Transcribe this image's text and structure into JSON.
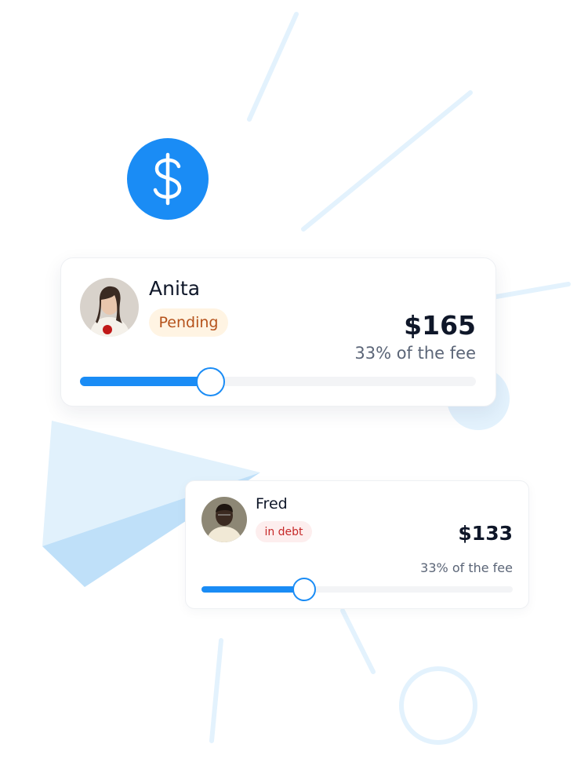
{
  "accent_color": "#1a8cf5",
  "header": {
    "icon": "dollar-icon"
  },
  "cards": [
    {
      "name": "Anita",
      "status": "Pending",
      "status_color": "#b5521b",
      "status_bg": "#fff4e3",
      "amount": "$165",
      "share_text": "33% of the fee",
      "slider_fraction": 0.33,
      "avatar_icon": "avatar-anita"
    },
    {
      "name": "Fred",
      "status": "in debt",
      "status_color": "#c62828",
      "status_bg": "#fdeeee",
      "amount": "$133",
      "share_text": "33% of the fee",
      "slider_fraction": 0.33,
      "avatar_icon": "avatar-fred"
    }
  ]
}
